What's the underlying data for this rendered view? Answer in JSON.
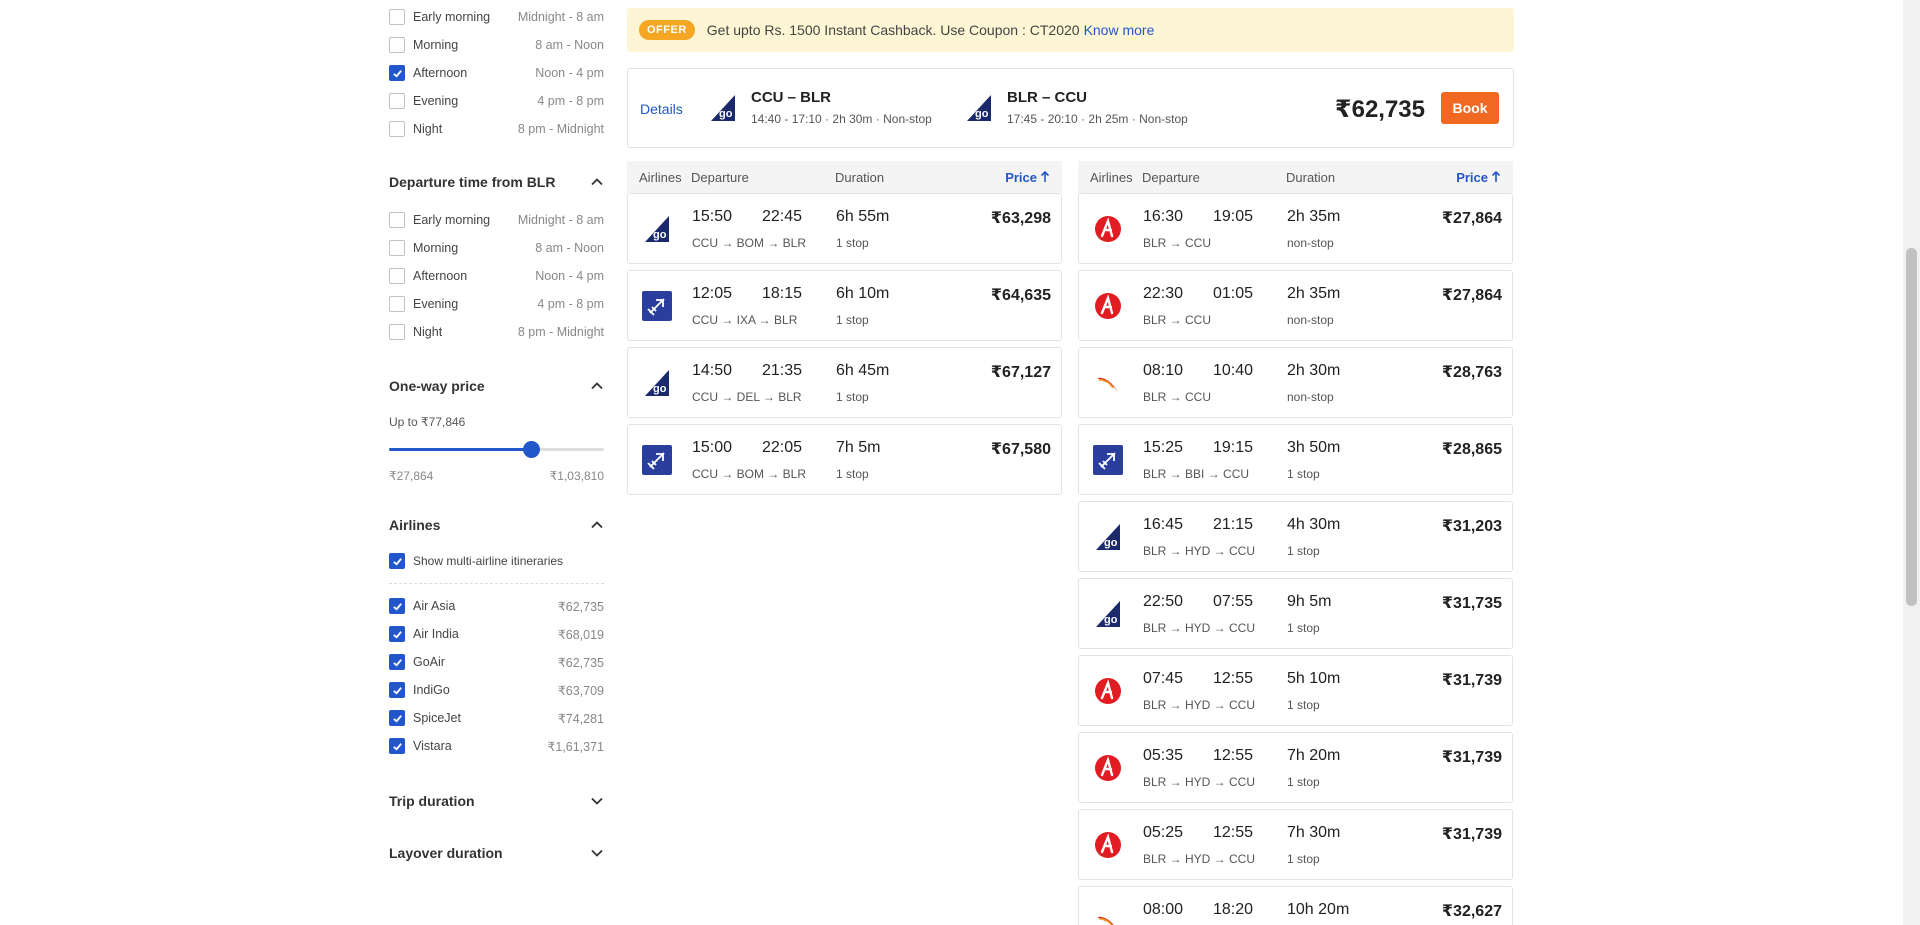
{
  "sidebar": {
    "onward_times": [
      {
        "label": "Early morning",
        "range": "Midnight - 8 am",
        "checked": false
      },
      {
        "label": "Morning",
        "range": "8 am - Noon",
        "checked": false
      },
      {
        "label": "Afternoon",
        "range": "Noon - 4 pm",
        "checked": true
      },
      {
        "label": "Evening",
        "range": "4 pm - 8 pm",
        "checked": false
      },
      {
        "label": "Night",
        "range": "8 pm - Midnight",
        "checked": false
      }
    ],
    "return_section_title": "Departure time from BLR",
    "return_times": [
      {
        "label": "Early morning",
        "range": "Midnight - 8 am",
        "checked": false
      },
      {
        "label": "Morning",
        "range": "8 am - Noon",
        "checked": false
      },
      {
        "label": "Afternoon",
        "range": "Noon - 4 pm",
        "checked": false
      },
      {
        "label": "Evening",
        "range": "4 pm - 8 pm",
        "checked": false
      },
      {
        "label": "Night",
        "range": "8 pm - Midnight",
        "checked": false
      }
    ],
    "price_section_title": "One-way price",
    "price_upto": "Up to ₹77,846",
    "price_min": "₹27,864",
    "price_max": "₹1,03,810",
    "price_slider_fraction": 0.66,
    "airlines_section_title": "Airlines",
    "multi_airline_label": "Show multi-airline itineraries",
    "multi_airline_checked": true,
    "airlines": [
      {
        "label": "Air Asia",
        "price": "₹62,735",
        "checked": true
      },
      {
        "label": "Air India",
        "price": "₹68,019",
        "checked": true
      },
      {
        "label": "GoAir",
        "price": "₹62,735",
        "checked": true
      },
      {
        "label": "IndiGo",
        "price": "₹63,709",
        "checked": true
      },
      {
        "label": "SpiceJet",
        "price": "₹74,281",
        "checked": true
      },
      {
        "label": "Vistara",
        "price": "₹1,61,371",
        "checked": true
      }
    ],
    "trip_duration_title": "Trip duration",
    "layover_duration_title": "Layover duration"
  },
  "offer": {
    "badge": "OFFER",
    "text": "Get upto Rs. 1500 Instant Cashback. Use Coupon : CT2020",
    "link": "Know more"
  },
  "summary": {
    "details_link": "Details",
    "onward": {
      "route": "CCU – BLR",
      "times": "14:40 - 17:10",
      "duration": "2h 30m",
      "stops": "Non-stop",
      "airline_icon": "goair"
    },
    "return": {
      "route": "BLR – CCU",
      "times": "17:45 - 20:10",
      "duration": "2h 25m",
      "stops": "Non-stop",
      "airline_icon": "goair"
    },
    "total_price": "₹62,735",
    "book_label": "Book"
  },
  "columns": {
    "airlines": "Airlines",
    "departure": "Departure",
    "duration": "Duration",
    "price": "Price"
  },
  "onward_flights": [
    {
      "airline_icon": "goair",
      "dep": "15:50",
      "arr": "22:45",
      "duration": "6h 55m",
      "price": "₹63,298",
      "path": "CCU → BOM → BLR",
      "stops": "1 stop"
    },
    {
      "airline_icon": "plane-blue",
      "dep": "12:05",
      "arr": "18:15",
      "duration": "6h 10m",
      "price": "₹64,635",
      "path": "CCU → IXA → BLR",
      "stops": "1 stop"
    },
    {
      "airline_icon": "goair",
      "dep": "14:50",
      "arr": "21:35",
      "duration": "6h 45m",
      "price": "₹67,127",
      "path": "CCU → DEL → BLR",
      "stops": "1 stop"
    },
    {
      "airline_icon": "plane-blue",
      "dep": "15:00",
      "arr": "22:05",
      "duration": "7h 5m",
      "price": "₹67,580",
      "path": "CCU → BOM → BLR",
      "stops": "1 stop"
    }
  ],
  "return_flights": [
    {
      "airline_icon": "airasia",
      "dep": "16:30",
      "arr": "19:05",
      "duration": "2h 35m",
      "price": "₹27,864",
      "path": "BLR → CCU",
      "stops": "non-stop"
    },
    {
      "airline_icon": "airasia",
      "dep": "22:30",
      "arr": "01:05",
      "duration": "2h 35m",
      "price": "₹27,864",
      "path": "BLR → CCU",
      "stops": "non-stop"
    },
    {
      "airline_icon": "airindia",
      "dep": "08:10",
      "arr": "10:40",
      "duration": "2h 30m",
      "price": "₹28,763",
      "path": "BLR → CCU",
      "stops": "non-stop"
    },
    {
      "airline_icon": "plane-blue",
      "dep": "15:25",
      "arr": "19:15",
      "duration": "3h 50m",
      "price": "₹28,865",
      "path": "BLR → BBI → CCU",
      "stops": "1 stop"
    },
    {
      "airline_icon": "goair",
      "dep": "16:45",
      "arr": "21:15",
      "duration": "4h 30m",
      "price": "₹31,203",
      "path": "BLR → HYD → CCU",
      "stops": "1 stop"
    },
    {
      "airline_icon": "goair",
      "dep": "22:50",
      "arr": "07:55",
      "duration": "9h 5m",
      "price": "₹31,735",
      "path": "BLR → HYD → CCU",
      "stops": "1 stop"
    },
    {
      "airline_icon": "airasia",
      "dep": "07:45",
      "arr": "12:55",
      "duration": "5h 10m",
      "price": "₹31,739",
      "path": "BLR → HYD → CCU",
      "stops": "1 stop"
    },
    {
      "airline_icon": "airasia",
      "dep": "05:35",
      "arr": "12:55",
      "duration": "7h 20m",
      "price": "₹31,739",
      "path": "BLR → HYD → CCU",
      "stops": "1 stop"
    },
    {
      "airline_icon": "airasia",
      "dep": "05:25",
      "arr": "12:55",
      "duration": "7h 30m",
      "price": "₹31,739",
      "path": "BLR → HYD → CCU",
      "stops": "1 stop"
    },
    {
      "airline_icon": "airindia",
      "dep": "08:00",
      "arr": "18:20",
      "duration": "10h 20m",
      "price": "₹32,627",
      "path": "",
      "stops": ""
    }
  ],
  "colors": {
    "accent": "#2257c9",
    "book": "#f16822",
    "offer_bg": "#fdf5d3",
    "offer_badge": "#f5a623",
    "airasia": "#e11c22",
    "goair": "#1a2a6c"
  }
}
